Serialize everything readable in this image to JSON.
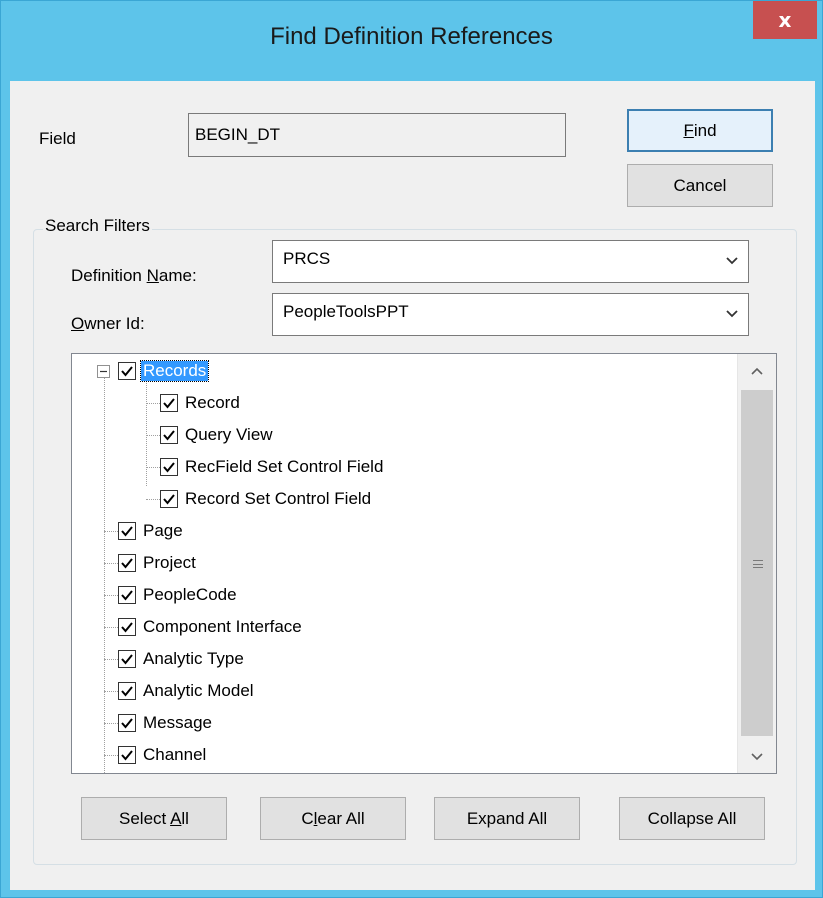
{
  "window": {
    "title": "Find Definition References",
    "close_glyph": "x"
  },
  "field": {
    "label": "Field",
    "value": "BEGIN_DT"
  },
  "buttons": {
    "find": {
      "pre": "",
      "mnemonic": "F",
      "post": "ind"
    },
    "cancel": "Cancel",
    "select_all": {
      "pre": "Select ",
      "mnemonic": "A",
      "post": "ll"
    },
    "clear_all": {
      "pre": "C",
      "mnemonic": "l",
      "post": "ear All"
    },
    "expand_all": "Expand All",
    "collapse_all": "Collapse All"
  },
  "filters": {
    "group_title": "Search Filters",
    "definition_name": {
      "pre": "Definition ",
      "mnemonic": "N",
      "post": "ame:",
      "value": "PRCS"
    },
    "owner_id": {
      "pre": "",
      "mnemonic": "O",
      "post": "wner Id:",
      "value": "PeopleToolsPPT"
    }
  },
  "tree": {
    "root": {
      "label": "Records",
      "checked": true,
      "expanded": true,
      "selected": true
    },
    "children": [
      "Record",
      "Query View",
      "RecField Set Control Field",
      "Record Set Control Field"
    ],
    "items": [
      "Page",
      "Project",
      "PeopleCode",
      "Component Interface",
      "Analytic Type",
      "Analytic Model",
      "Message",
      "Channel"
    ]
  },
  "icons": {
    "expander": "minus-box-icon",
    "check": "check-icon",
    "dropdown": "chevron-down-icon",
    "scroll_up": "chevron-up-icon",
    "scroll_down": "chevron-down-icon"
  },
  "colors": {
    "titlebar": "#5dc4ea",
    "close": "#c75050",
    "selection": "#3399ff",
    "default_button_border": "#3c7fb1"
  }
}
